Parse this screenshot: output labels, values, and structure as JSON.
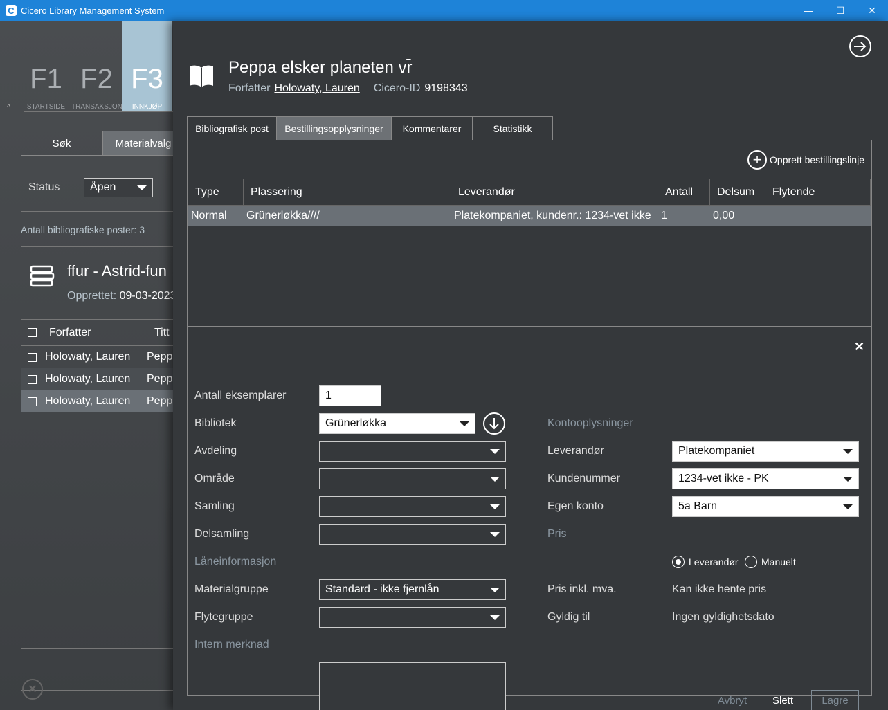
{
  "window": {
    "title": "Cicero Library Management System",
    "minimize": "—",
    "maximize": "☐",
    "close": "✕"
  },
  "left": {
    "fkeys": [
      {
        "key": "F1",
        "label": "STARTSIDE"
      },
      {
        "key": "F2",
        "label": "TRANSAKSJON"
      },
      {
        "key": "F3",
        "label": "INNKJØP"
      }
    ],
    "tabs": [
      "Søk",
      "Materialvalg"
    ],
    "status_label": "Status",
    "status_value": "Åpen",
    "count_text": "Antall bibliografiske poster: 3",
    "record_title": "ffur - Astrid-fun",
    "record_created_label": "Opprettet:",
    "record_created_value": "09-03-2023",
    "table_headers": [
      "Forfatter",
      "Titt"
    ],
    "rows": [
      {
        "author": "Holowaty, Lauren",
        "title": "Pepp"
      },
      {
        "author": "Holowaty, Lauren",
        "title": "Pepp"
      },
      {
        "author": "Holowaty, Lauren",
        "title": "Pepp"
      }
    ]
  },
  "header": {
    "title": "Peppa elsker planeten vr̄",
    "author_label": "Forfatter",
    "author": "Holowaty, Lauren",
    "cicero_label": "Cicero-ID",
    "cicero_id": "9198343"
  },
  "tabs": [
    "Bibliografisk post",
    "Bestillingsopplysninger",
    "Kommentarer",
    "Statistikk"
  ],
  "create_label": "Opprett bestillingslinje",
  "grid": {
    "headers": [
      "Type",
      "Plassering",
      "Leverandør",
      "Antall",
      "Delsum",
      "Flytende"
    ],
    "row": [
      "Normal",
      "Grünerløkka////",
      "Platekompaniet, kundenr.: 1234-vet ikke",
      "1",
      "0,00",
      ""
    ]
  },
  "form": {
    "antall_label": "Antall eksemplarer",
    "antall_value": "1",
    "bibliotek_label": "Bibliotek",
    "bibliotek_value": "Grünerløkka",
    "avdeling_label": "Avdeling",
    "omrade_label": "Område",
    "samling_label": "Samling",
    "delsamling_label": "Delsamling",
    "laan_section": "Låneinformasjon",
    "materialgruppe_label": "Materialgruppe",
    "materialgruppe_value": "Standard - ikke fjernlån",
    "flytegruppe_label": "Flytegruppe",
    "merknad_section": "Intern merknad",
    "konto_section": "Kontooplysninger",
    "leverandor_label": "Leverandør",
    "leverandor_value": "Platekompaniet",
    "kundenummer_label": "Kundenummer",
    "kundenummer_value": "1234-vet ikke - PK",
    "egenkonto_label": "Egen konto",
    "egenkonto_value": "5a Barn",
    "pris_section": "Pris",
    "radio_leverandor": "Leverandør",
    "radio_manuelt": "Manuelt",
    "pris_label": "Pris inkl. mva.",
    "pris_value": "Kan ikke hente pris",
    "gyldig_label": "Gyldig til",
    "gyldig_value": "Ingen gyldighetsdato",
    "avbryt": "Avbryt",
    "slett": "Slett",
    "lagre": "Lagre"
  }
}
